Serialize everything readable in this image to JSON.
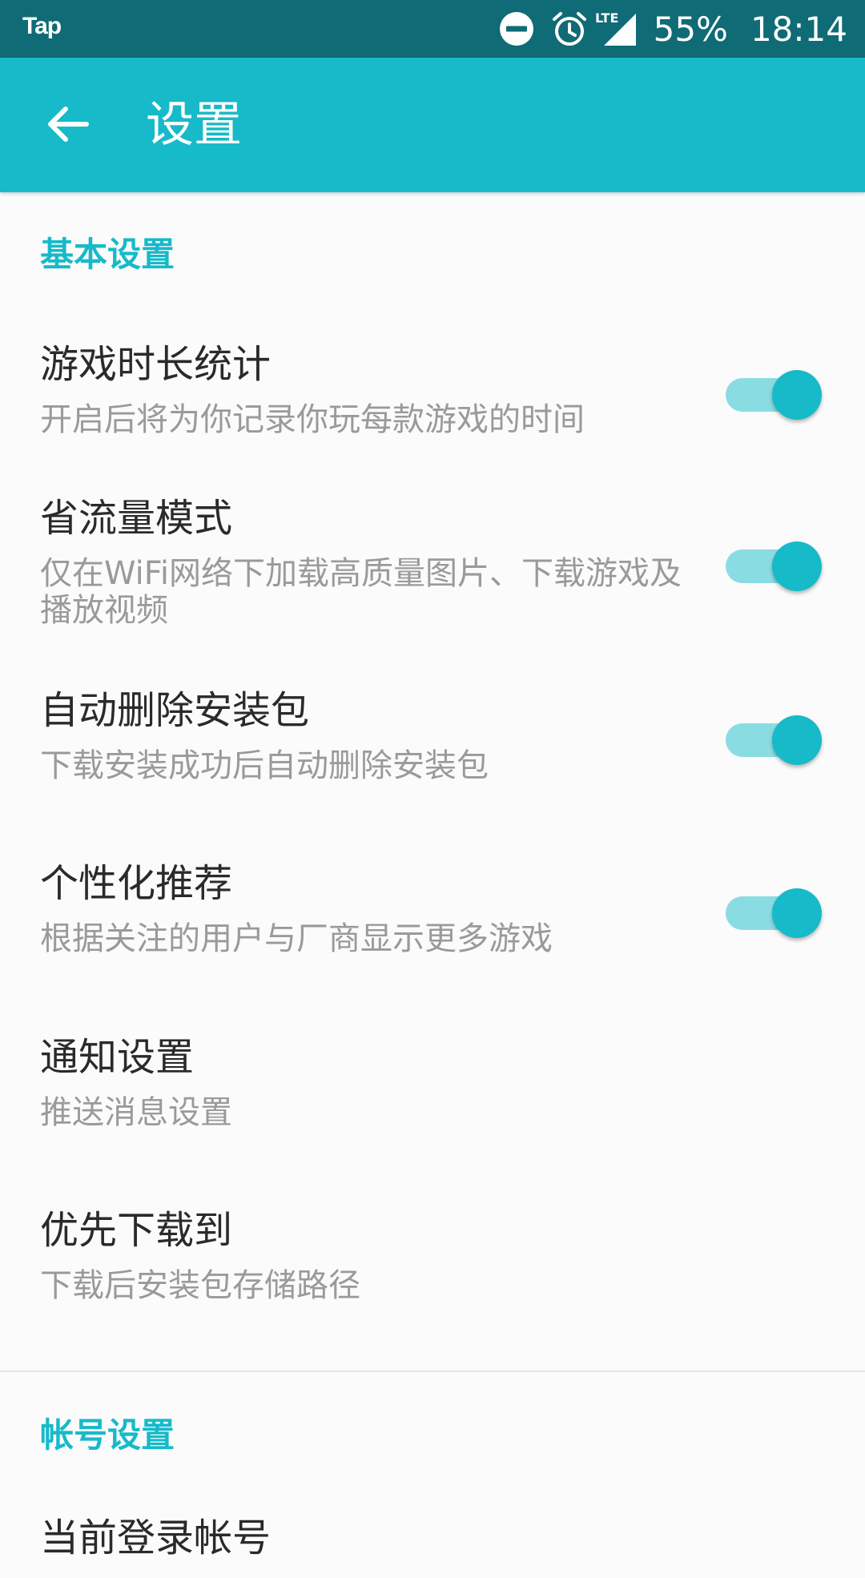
{
  "status_bar": {
    "app_label": "Tap",
    "battery": "55%",
    "time": "18:14",
    "icons": [
      "do-not-disturb-icon",
      "alarm-icon",
      "lte-signal-icon"
    ]
  },
  "app_bar": {
    "title": "设置",
    "back_icon": "arrow-left-icon"
  },
  "sections": {
    "basic": {
      "header": "基本设置",
      "items": [
        {
          "title": "游戏时长统计",
          "subtitle": "开启后将为你记录你玩每款游戏的时间",
          "toggle_on": true
        },
        {
          "title": "省流量模式",
          "subtitle": "仅在WiFi网络下加载高质量图片、下载游戏及播放视频",
          "toggle_on": true
        },
        {
          "title": "自动删除安装包",
          "subtitle": "下载安装成功后自动删除安装包",
          "toggle_on": true
        },
        {
          "title": "个性化推荐",
          "subtitle": "根据关注的用户与厂商显示更多游戏",
          "toggle_on": true
        },
        {
          "title": "通知设置",
          "subtitle": "推送消息设置"
        },
        {
          "title": "优先下载到",
          "subtitle": "下载后安装包存储路径"
        }
      ]
    },
    "account": {
      "header": "帐号设置",
      "items": [
        {
          "title": "当前登录帐号"
        }
      ]
    }
  },
  "colors": {
    "status_bar_bg": "#0f6b75",
    "app_bar_bg": "#16bac9",
    "accent": "#16bac9",
    "toggle_track_on": "#8adce3",
    "title_text": "#2a2a2a",
    "subtitle_text": "#9a9a9a",
    "background": "#fbfbfb"
  }
}
